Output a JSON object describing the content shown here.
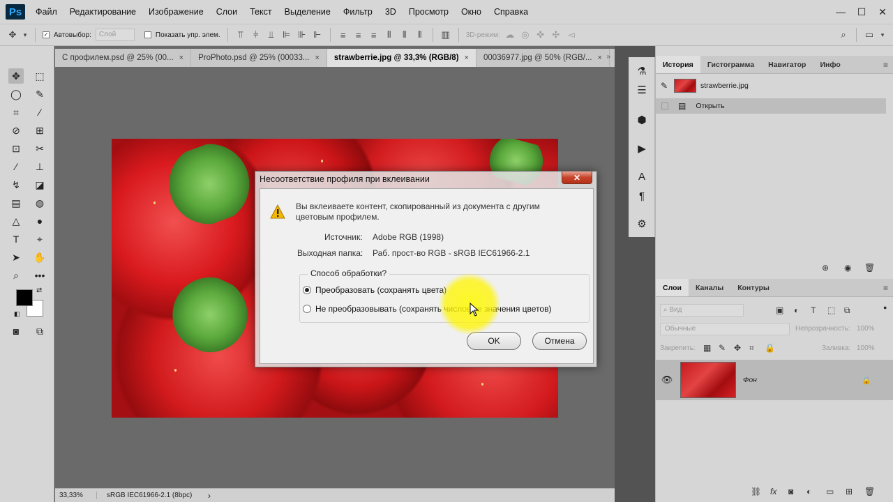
{
  "app": {
    "logo": "Ps"
  },
  "menu": [
    "Файл",
    "Редактирование",
    "Изображение",
    "Слои",
    "Текст",
    "Выделение",
    "Фильтр",
    "3D",
    "Просмотр",
    "Окно",
    "Справка"
  ],
  "window_buttons": {
    "minimize": "—",
    "maximize": "☐",
    "close": "✕"
  },
  "options": {
    "autoselect_label": "Автовыбор:",
    "autoselect_value": "Слой",
    "show_controls_label": "Показать упр. элем.",
    "mode3d_label": "3D-режим:"
  },
  "tabs": [
    {
      "label": "С профилем.psd @ 25% (00...",
      "close": "×"
    },
    {
      "label": "ProPhoto.psd @ 25% (00033...",
      "close": "×"
    },
    {
      "label": "strawberrie.jpg @ 33,3% (RGB/8)",
      "close": "×",
      "active": true
    },
    {
      "label": "00036977.jpg @ 50% (RGB/...",
      "close": "×"
    }
  ],
  "status": {
    "zoom": "33,33%",
    "profile": "sRGB IEC61966-2.1 (8bpc)",
    "arrow": "›"
  },
  "history_panel": {
    "tabs": [
      "История",
      "Гистограмма",
      "Навигатор",
      "Инфо"
    ],
    "snapshot": "strawberrie.jpg",
    "steps": [
      "Открыть"
    ]
  },
  "layers_panel": {
    "tabs": [
      "Слои",
      "Каналы",
      "Контуры"
    ],
    "search_placeholder": "Вид",
    "blend_mode": "Обычные",
    "opacity_label": "Непрозрачность:",
    "opacity_value": "100%",
    "lock_label": "Закрепить:",
    "fill_label": "Заливка:",
    "fill_value": "100%",
    "layers": [
      {
        "name": "Фон",
        "locked": true,
        "visible": true
      }
    ]
  },
  "dialog": {
    "title": "Несоответствие профиля при вклеивании",
    "close": "✕",
    "message_line1": "Вы вклеиваете контент, скопированный из документа с другим",
    "message_line2": "цветовым профилем.",
    "source_label": "Источник:",
    "source_value": "Adobe RGB (1998)",
    "dest_label": "Выходная папка:",
    "dest_value": "Раб. прост-во RGB - sRGB IEC61966-2.1",
    "group_label": "Способ обработки?",
    "options": [
      {
        "label": "Преобразовать (сохранять цвета)",
        "selected": true
      },
      {
        "label": "Не преобразовывать (сохранять числовые значения цветов)",
        "selected": false
      }
    ],
    "ok": "OK",
    "cancel": "Отмена"
  },
  "colors": {
    "foreground": "#000000",
    "background": "#ffffff",
    "highlight": "#fff500"
  }
}
